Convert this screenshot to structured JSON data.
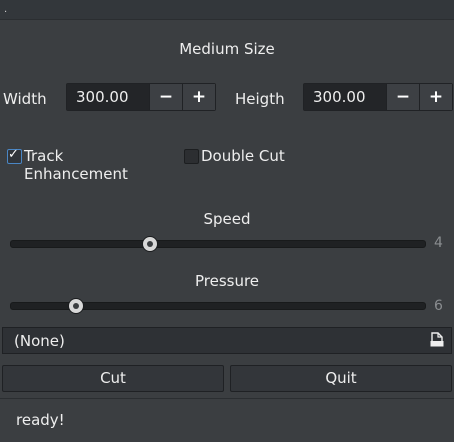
{
  "window": {
    "title_glyph": "."
  },
  "heading": "Medium Size",
  "width": {
    "label": "Width",
    "value": "300.00",
    "minus": "−",
    "plus": "+"
  },
  "height": {
    "label": "Heigth",
    "value": "300.00",
    "minus": "−",
    "plus": "+"
  },
  "options": {
    "track_enhancement": {
      "label": "Track Enhancement",
      "checked": true
    },
    "double_cut": {
      "label": "Double Cut",
      "checked": false
    }
  },
  "speed": {
    "label": "Speed",
    "value": "4",
    "level": 0.336
  },
  "pressure": {
    "label": "Pressure",
    "value": "6",
    "level": 0.157
  },
  "file": {
    "selected": "(None)",
    "icon": "file-open-icon"
  },
  "buttons": {
    "cut": "Cut",
    "quit": "Quit"
  },
  "status": "ready!"
}
